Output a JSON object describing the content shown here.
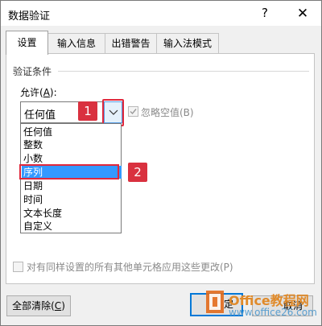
{
  "window": {
    "title": "数据验证",
    "help_glyph": "?",
    "close_glyph": "✕"
  },
  "tabs": [
    {
      "label": "设置",
      "active": true
    },
    {
      "label": "输入信息",
      "active": false
    },
    {
      "label": "出错警告",
      "active": false
    },
    {
      "label": "输入法模式",
      "active": false
    }
  ],
  "validation": {
    "group_label": "验证条件",
    "allow_label_prefix": "允许(",
    "allow_label_hotkey": "A",
    "allow_label_suffix": "):",
    "allow_value": "任何值",
    "ignore_blank_label": "忽略空值(B)",
    "ignore_blank_checked": true,
    "ignore_blank_enabled": false,
    "options": [
      "任何值",
      "整数",
      "小数",
      "序列",
      "日期",
      "时间",
      "文本长度",
      "自定义"
    ],
    "selected_option": "序列"
  },
  "apply_all": {
    "label": "对有同样设置的所有其他单元格应用这些更改(P)",
    "checked": false,
    "enabled": false
  },
  "buttons": {
    "clear_prefix": "全部清除(",
    "clear_hotkey": "C",
    "clear_suffix": ")",
    "ok_label": "定",
    "cancel_label": "取消"
  },
  "callouts": [
    "1",
    "2"
  ],
  "watermark": {
    "line1": "Office教程网",
    "line2": "www.office26.com"
  },
  "colors": {
    "callout": "#d9313f",
    "selection": "#3399ff",
    "focus_border": "#0078d7",
    "watermark_orange": "#e08a2a"
  }
}
